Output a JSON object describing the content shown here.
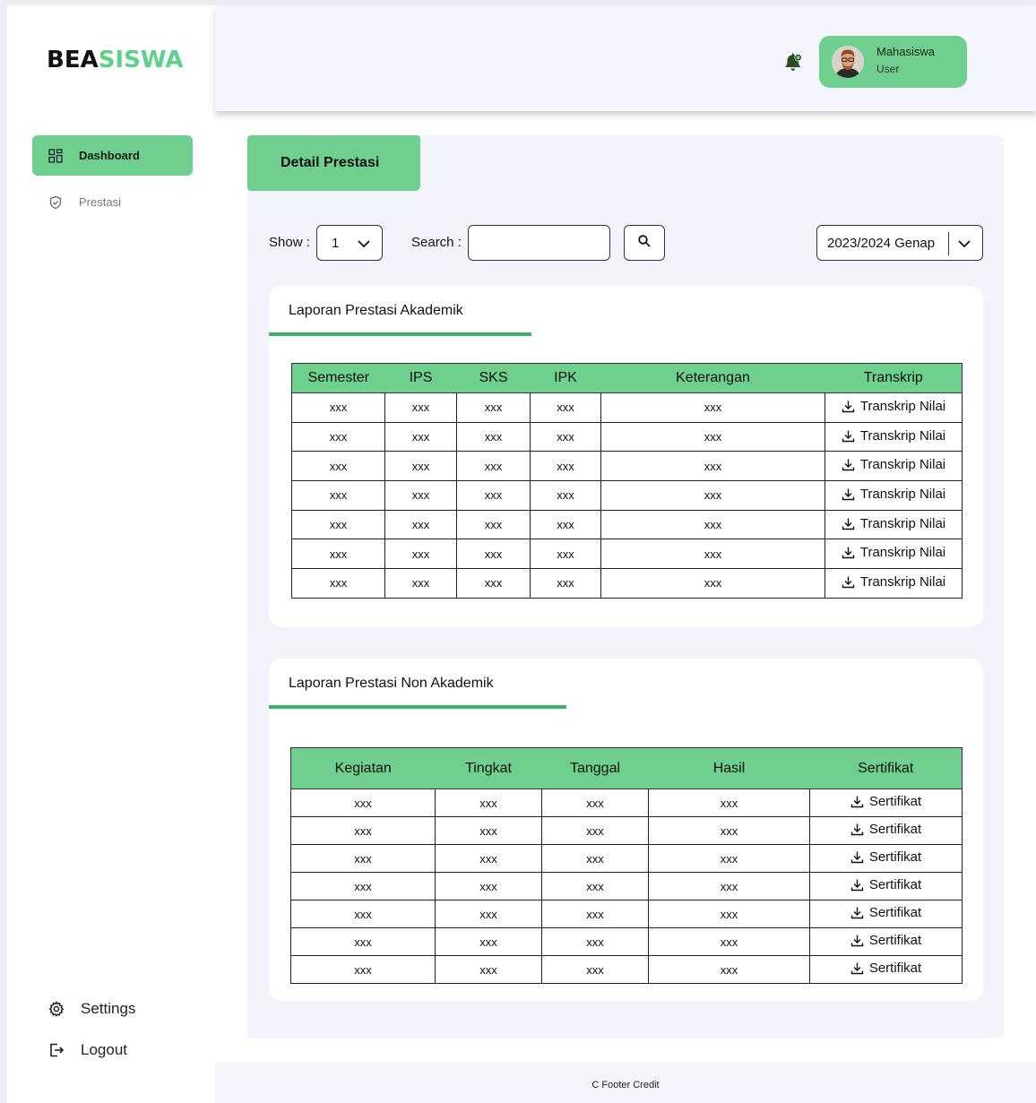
{
  "brand": {
    "part1": "BEA",
    "part2": "SISWA",
    "accent": "#5fd08a"
  },
  "sidebar": {
    "items": [
      {
        "label": "Dashboard",
        "icon": "dashboard-icon",
        "active": true
      },
      {
        "label": "Prestasi",
        "icon": "shield-check-icon",
        "active": false
      }
    ],
    "bottom": [
      {
        "label": "Settings",
        "icon": "gear-icon"
      },
      {
        "label": "Logout",
        "icon": "logout-icon"
      }
    ]
  },
  "header": {
    "user": {
      "name": "Mahasiswa",
      "role": "User"
    },
    "notification_icon": "bell-icon"
  },
  "main": {
    "title": "Detail Prestasi",
    "show_label": "Show :",
    "show_value": "1",
    "search_label": "Search :",
    "search_value": "",
    "period": "2023/2024 Genap",
    "akademik": {
      "title": "Laporan Prestasi Akademik",
      "columns": [
        "Semester",
        "IPS",
        "SKS",
        "IPK",
        "Keterangan",
        "Transkrip"
      ],
      "rows": [
        [
          "xxx",
          "xxx",
          "xxx",
          "xxx",
          "xxx",
          "Transkrip Nilai"
        ],
        [
          "xxx",
          "xxx",
          "xxx",
          "xxx",
          "xxx",
          "Transkrip Nilai"
        ],
        [
          "xxx",
          "xxx",
          "xxx",
          "xxx",
          "xxx",
          "Transkrip Nilai"
        ],
        [
          "xxx",
          "xxx",
          "xxx",
          "xxx",
          "xxx",
          "Transkrip Nilai"
        ],
        [
          "xxx",
          "xxx",
          "xxx",
          "xxx",
          "xxx",
          "Transkrip Nilai"
        ],
        [
          "xxx",
          "xxx",
          "xxx",
          "xxx",
          "xxx",
          "Transkrip Nilai"
        ],
        [
          "xxx",
          "xxx",
          "xxx",
          "xxx",
          "xxx",
          "Transkrip Nilai"
        ]
      ]
    },
    "non_akademik": {
      "title": "Laporan Prestasi Non Akademik",
      "columns": [
        "Kegiatan",
        "Tingkat",
        "Tanggal",
        "Hasil",
        "Sertifikat"
      ],
      "rows": [
        [
          "xxx",
          "xxx",
          "xxx",
          "xxx",
          "Sertifikat"
        ],
        [
          "xxx",
          "xxx",
          "xxx",
          "xxx",
          "Sertifikat"
        ],
        [
          "xxx",
          "xxx",
          "xxx",
          "xxx",
          "Sertifikat"
        ],
        [
          "xxx",
          "xxx",
          "xxx",
          "xxx",
          "Sertifikat"
        ],
        [
          "xxx",
          "xxx",
          "xxx",
          "xxx",
          "Sertifikat"
        ],
        [
          "xxx",
          "xxx",
          "xxx",
          "xxx",
          "Sertifikat"
        ],
        [
          "xxx",
          "xxx",
          "xxx",
          "xxx",
          "Sertifikat"
        ]
      ]
    }
  },
  "footer": {
    "text": "C Footer Credit"
  }
}
